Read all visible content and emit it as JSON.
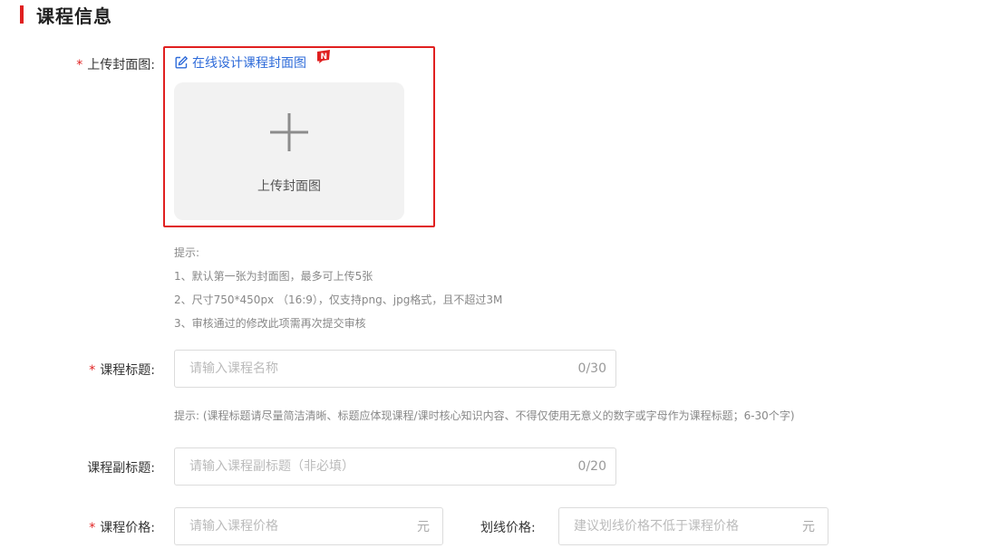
{
  "section": {
    "title": "课程信息"
  },
  "cover": {
    "required_mark": "*",
    "label": "上传封面图:",
    "design_link": "在线设计课程封面图",
    "new_badge": "N",
    "upload_text": "上传封面图",
    "tips": [
      "提示:",
      "1、默认第一张为封面图，最多可上传5张",
      "2、尺寸750*450px （16:9），仅支持png、jpg格式，且不超过3M",
      "3、审核通过的修改此项需再次提交审核"
    ]
  },
  "title_field": {
    "required_mark": "*",
    "label": "课程标题:",
    "placeholder": "请输入课程名称",
    "counter": "0/30",
    "hint": "提示: (课程标题请尽量简洁清晰、标题应体现课程/课时核心知识内容、不得仅使用无意义的数字或字母作为课程标题；6-30个字)"
  },
  "subtitle_field": {
    "label": "课程副标题:",
    "placeholder": "请输入课程副标题（非必填）",
    "counter": "0/20"
  },
  "price_field": {
    "required_mark": "*",
    "label": "课程价格:",
    "placeholder": "请输入课程价格",
    "unit": "元"
  },
  "strike_price_field": {
    "label": "划线价格:",
    "placeholder": "建议划线价格不低于课程价格",
    "unit": "元"
  },
  "colors": {
    "accent_red": "#e02020",
    "link_blue": "#2e6bd9"
  }
}
